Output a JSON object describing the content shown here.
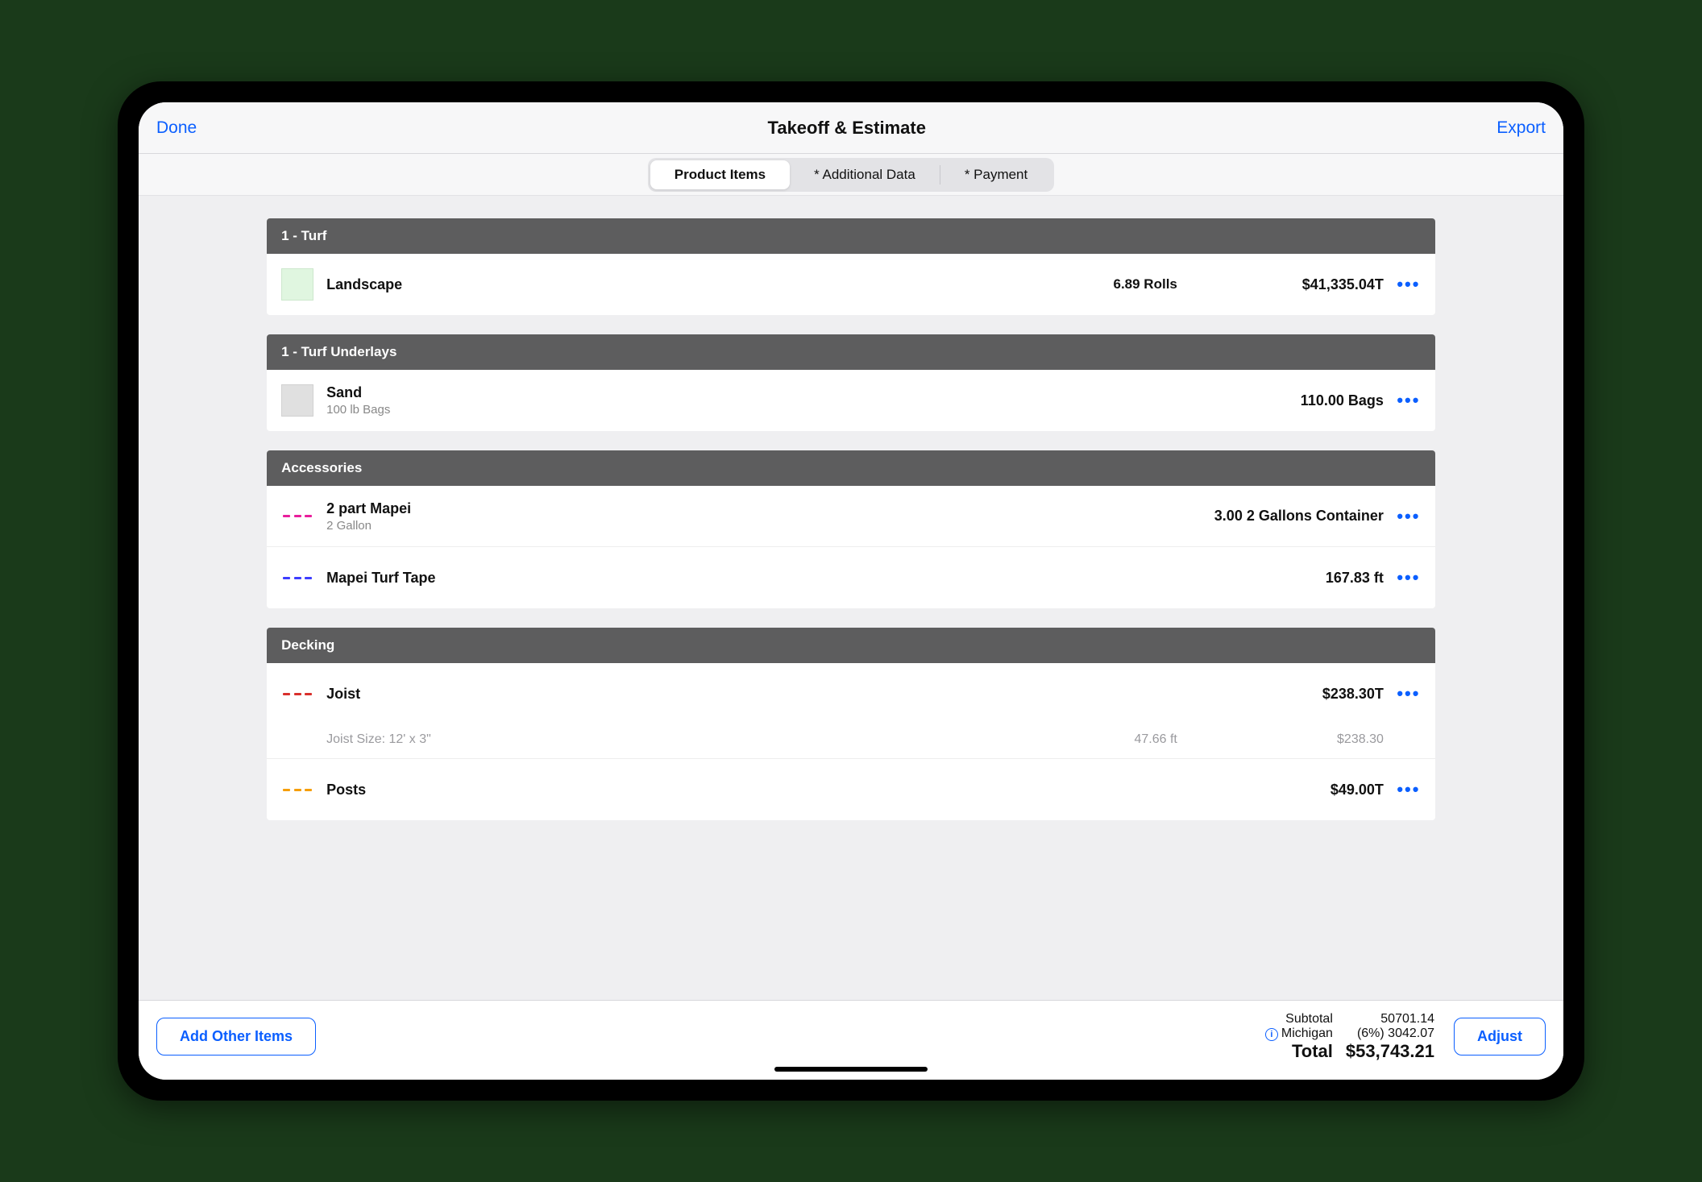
{
  "nav": {
    "done": "Done",
    "title": "Takeoff & Estimate",
    "export": "Export"
  },
  "tabs": {
    "t0": "Product Items",
    "t1": "* Additional Data",
    "t2": "* Payment"
  },
  "sections": {
    "s0": {
      "title": "1 - Turf"
    },
    "s1": {
      "title": "1 - Turf Underlays"
    },
    "s2": {
      "title": "Accessories"
    },
    "s3": {
      "title": "Decking"
    }
  },
  "rows": {
    "landscape": {
      "title": "Landscape",
      "qty": "6.89 Rolls",
      "price": "$41,335.04T"
    },
    "sand": {
      "title": "Sand",
      "sub": "100 lb Bags",
      "qty": "110.00 Bags"
    },
    "mapei2": {
      "title": "2 part Mapei",
      "sub": "2 Gallon",
      "qty": "3.00 2 Gallons Container"
    },
    "tape": {
      "title": "Mapei Turf Tape",
      "qty": "167.83 ft"
    },
    "joist": {
      "title": "Joist",
      "price": "$238.30T",
      "detail_label": "Joist Size: 12' x 3\"",
      "detail_qty": "47.66 ft",
      "detail_price": "$238.30"
    },
    "posts": {
      "title": "Posts",
      "price": "$49.00T"
    }
  },
  "footer": {
    "add": "Add Other Items",
    "adjust": "Adjust",
    "subtotal_label": "Subtotal",
    "subtotal_value": "50701.14",
    "tax_label": "Michigan",
    "tax_value": "(6%) 3042.07",
    "total_label": "Total",
    "total_value": "$53,743.21"
  }
}
